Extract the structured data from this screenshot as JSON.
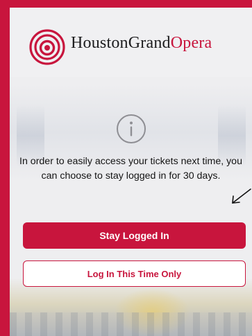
{
  "brand": {
    "name_primary": "HoustonGrand",
    "name_accent": "Opera",
    "accent_color": "#c8153d"
  },
  "dialog": {
    "icon": "info-icon",
    "message": "In order to easily access your tickets next time, you can choose to stay logged in for 30 days.",
    "primary_button": "Stay Logged In",
    "secondary_button": "Log In This Time Only"
  },
  "annotation": {
    "icon": "hand-drawn-arrow-icon"
  }
}
